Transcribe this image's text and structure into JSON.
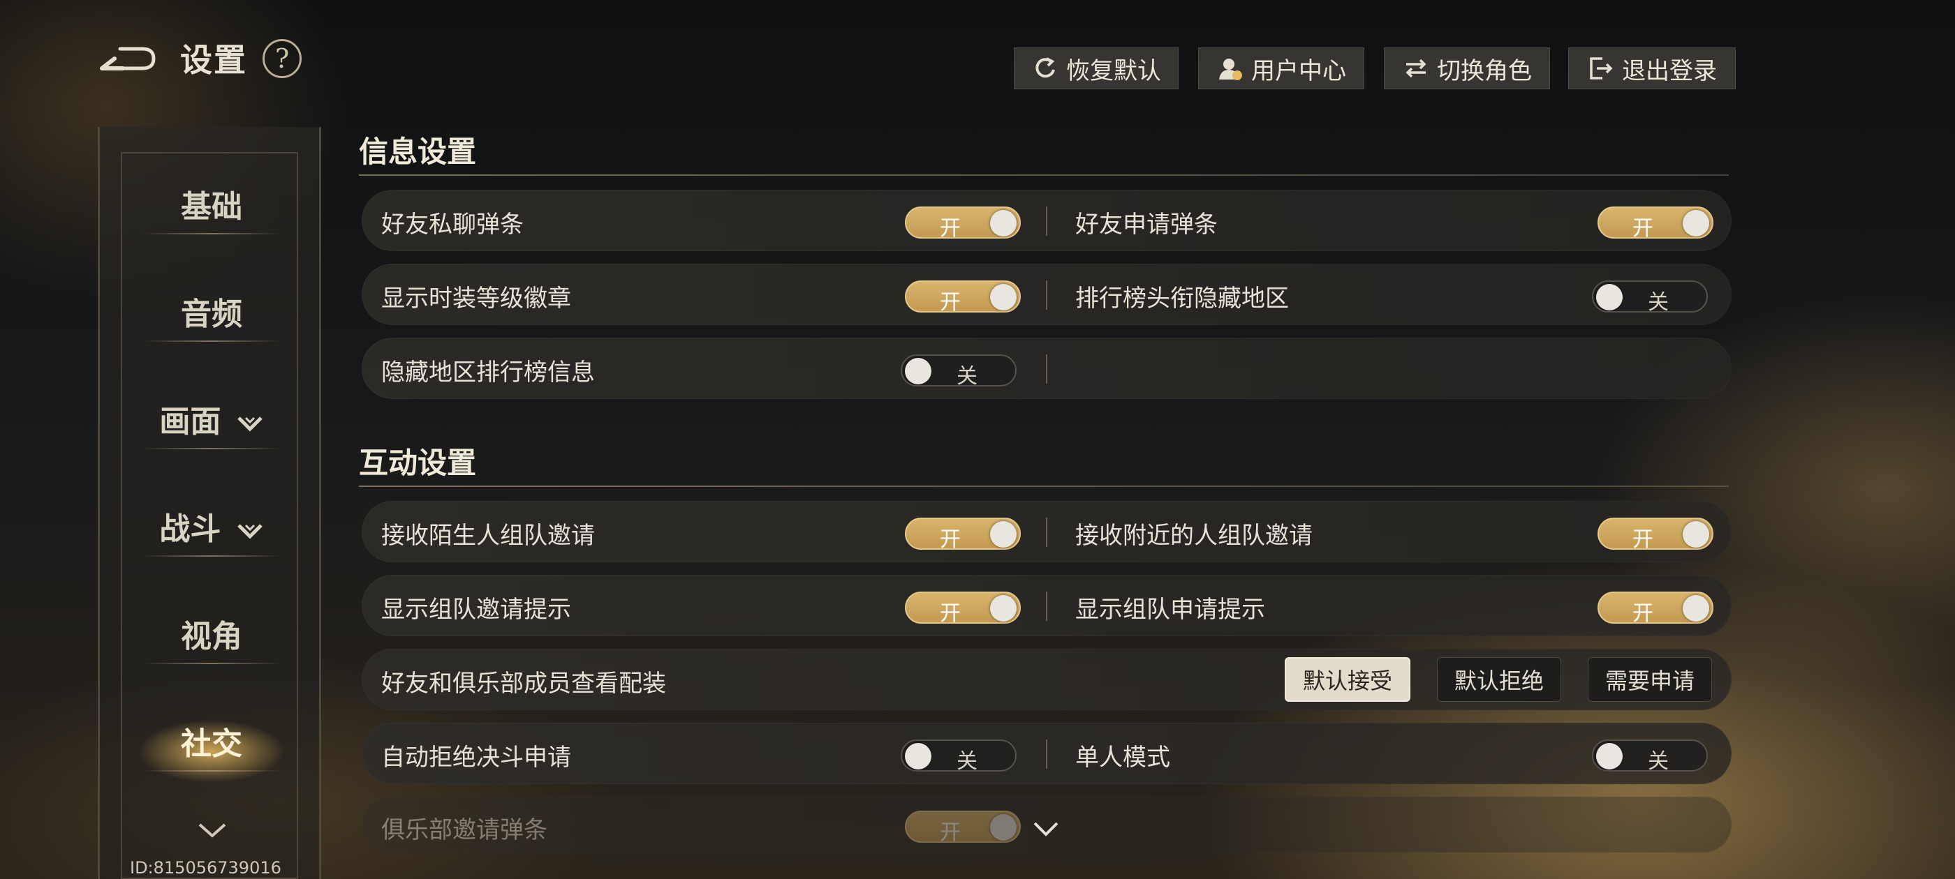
{
  "header": {
    "title": "设置",
    "help_glyph": "?"
  },
  "top_buttons": [
    {
      "label": "恢复默认",
      "icon": "restore-icon"
    },
    {
      "label": "用户中心",
      "icon": "user-center-icon"
    },
    {
      "label": "切换角色",
      "icon": "switch-icon"
    },
    {
      "label": "退出登录",
      "icon": "logout-icon"
    }
  ],
  "sidebar": {
    "items": [
      {
        "label": "基础",
        "expandable": false
      },
      {
        "label": "音频",
        "expandable": false
      },
      {
        "label": "画面",
        "expandable": true
      },
      {
        "label": "战斗",
        "expandable": true
      },
      {
        "label": "视角",
        "expandable": false
      },
      {
        "label": "社交",
        "expandable": false,
        "active": true
      }
    ]
  },
  "user_id": "ID:815056739016",
  "info_section": {
    "title": "信息设置",
    "rows": [
      {
        "left": {
          "label": "好友私聊弹条",
          "state": "开"
        },
        "right": {
          "label": "好友申请弹条",
          "state": "开"
        }
      },
      {
        "left": {
          "label": "显示时装等级徽章",
          "state": "开"
        },
        "right": {
          "label": "排行榜头衔隐藏地区",
          "state": "关"
        }
      },
      {
        "left": {
          "label": "隐藏地区排行榜信息",
          "state": "关"
        }
      }
    ]
  },
  "interact_section": {
    "title": "互动设置",
    "rows": [
      {
        "left": {
          "label": "接收陌生人组队邀请",
          "state": "开"
        },
        "right": {
          "label": "接收附近的人组队邀请",
          "state": "开"
        }
      },
      {
        "left": {
          "label": "显示组队邀请提示",
          "state": "开"
        },
        "right": {
          "label": "显示组队申请提示",
          "state": "开"
        }
      },
      {
        "label": "好友和俱乐部成员查看配装",
        "options": [
          "默认接受",
          "默认拒绝",
          "需要申请"
        ],
        "selected": "默认接受"
      },
      {
        "left": {
          "label": "自动拒绝决斗申请",
          "state": "关"
        },
        "right": {
          "label": "单人模式",
          "state": "关"
        }
      },
      {
        "left": {
          "label": "俱乐部邀请弹条",
          "state": "开"
        }
      }
    ]
  },
  "colors": {
    "toggle_on": "#d2ad65",
    "toggle_off": "#1e1e1e",
    "accent_gold": "#e8ba62"
  }
}
